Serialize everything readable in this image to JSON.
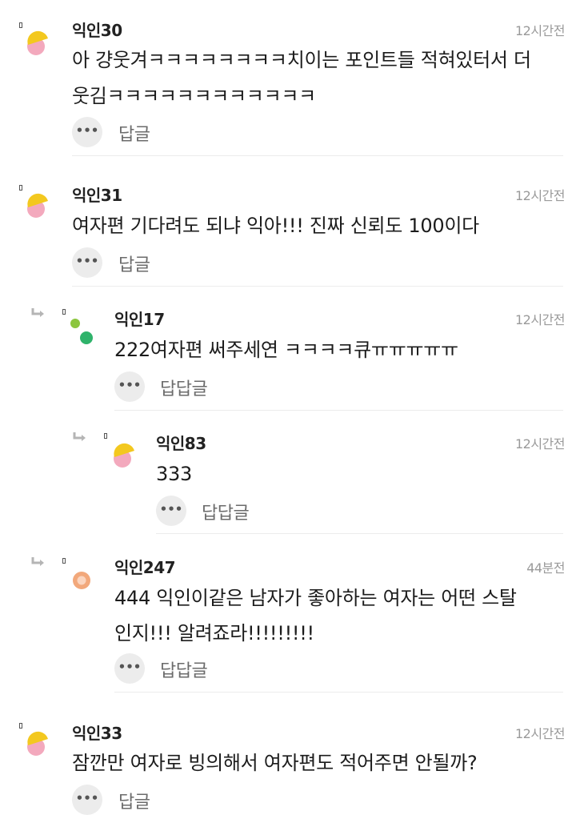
{
  "comments": [
    {
      "name": "익인30",
      "time": "12시간전",
      "lines": [
        "아 걍웃겨ㅋㅋㅋㅋㅋㅋㅋㅋ치이는 포인트들 적혀있터서 더",
        "웃김ㅋㅋㅋㅋㅋㅋㅋㅋㅋㅋㅋㅋ"
      ],
      "reply_label": "답글",
      "more": "•••",
      "avatar": "yellow-pink-avatar-icon"
    },
    {
      "name": "익인31",
      "time": "12시간전",
      "lines": [
        "여자편 기다려도 되냐 익아!!! 진짜 신뢰도 100이다"
      ],
      "reply_label": "답글",
      "more": "•••",
      "avatar": "yellow-pink-avatar-icon"
    },
    {
      "name": "익인17",
      "time": "12시간전",
      "lines": [
        "222여자편 써주세연 ㅋㅋㅋㅋ큐ㅠㅠㅠㅠㅠ"
      ],
      "reply_label": "답답글",
      "more": "•••",
      "avatar": "green-dots-avatar-icon"
    },
    {
      "name": "익인83",
      "time": "12시간전",
      "lines": [
        "333"
      ],
      "reply_label": "답답글",
      "more": "•••",
      "avatar": "yellow-pink-avatar-icon"
    },
    {
      "name": "익인247",
      "time": "44분전",
      "lines": [
        "444 익인이같은 남자가 좋아하는 여자는 어떤 스탈",
        "인지!!! 알려죠라!!!!!!!!!"
      ],
      "reply_label": "답답글",
      "more": "•••",
      "avatar": "orange-ring-avatar-icon"
    },
    {
      "name": "익인33",
      "time": "12시간전",
      "lines": [
        "잠깐만 여자로 빙의해서 여자편도 적어주면 안될까?"
      ],
      "reply_label": "답글",
      "more": "•••",
      "avatar": "yellow-pink-avatar-icon"
    }
  ],
  "colors": {
    "avatar_yellow": "#f3c81f",
    "avatar_pink": "#f3a9bd",
    "avatar_green_light": "#8cc63f",
    "avatar_green": "#2fb36b",
    "avatar_orange": "#f2a87b",
    "time_gray": "#9a9a9a",
    "button_bg": "#ececec",
    "separator": "#ececec"
  }
}
